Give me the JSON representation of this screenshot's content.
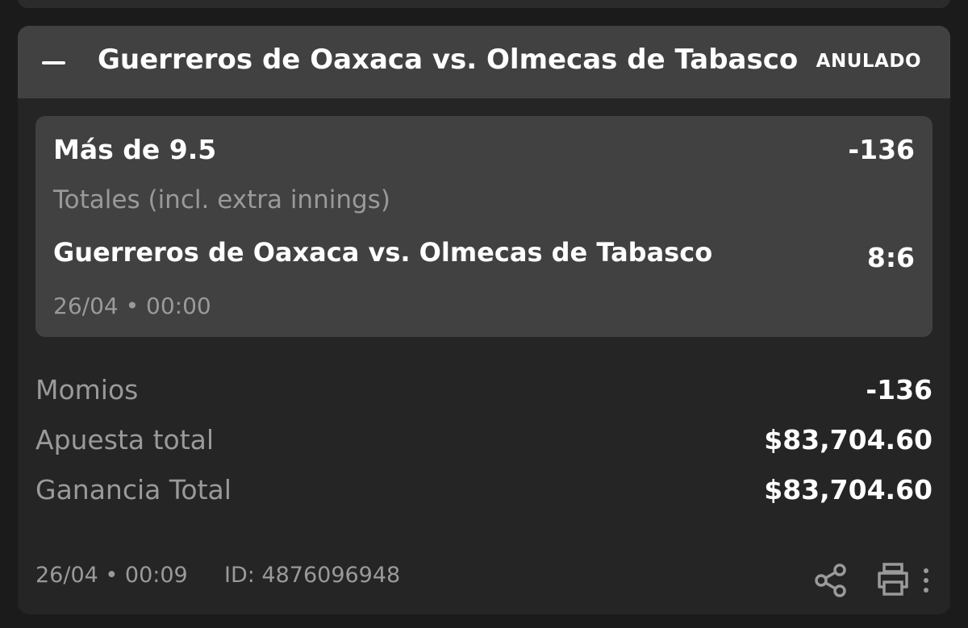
{
  "header": {
    "title": "Guerreros de Oaxaca vs. Olmecas de Tabasco",
    "status": "ANULADO"
  },
  "selection": {
    "name": "Más de 9.5",
    "odds": "-136",
    "market": "Totales (incl. extra innings)",
    "match": "Guerreros de Oaxaca vs. Olmecas de Tabasco",
    "score": "8:6",
    "datetime": "26/04 • 00:00"
  },
  "summary": {
    "odds_label": "Momios",
    "odds_value": "-136",
    "stake_label": "Apuesta total",
    "stake_value": "$83,704.60",
    "winnings_label": "Ganancia Total",
    "winnings_value": "$83,704.60"
  },
  "footer": {
    "datetime": "26/04 • 00:09",
    "id": "ID: 4876096948",
    "icons": [
      "share-icon",
      "print-icon",
      "more-vertical-icon"
    ]
  },
  "colors": {
    "background": "#1b1b1b",
    "card": "#252525",
    "header": "#414141",
    "selection_box": "#414141",
    "muted_text": "#9a9a9a",
    "text": "#ffffff"
  }
}
